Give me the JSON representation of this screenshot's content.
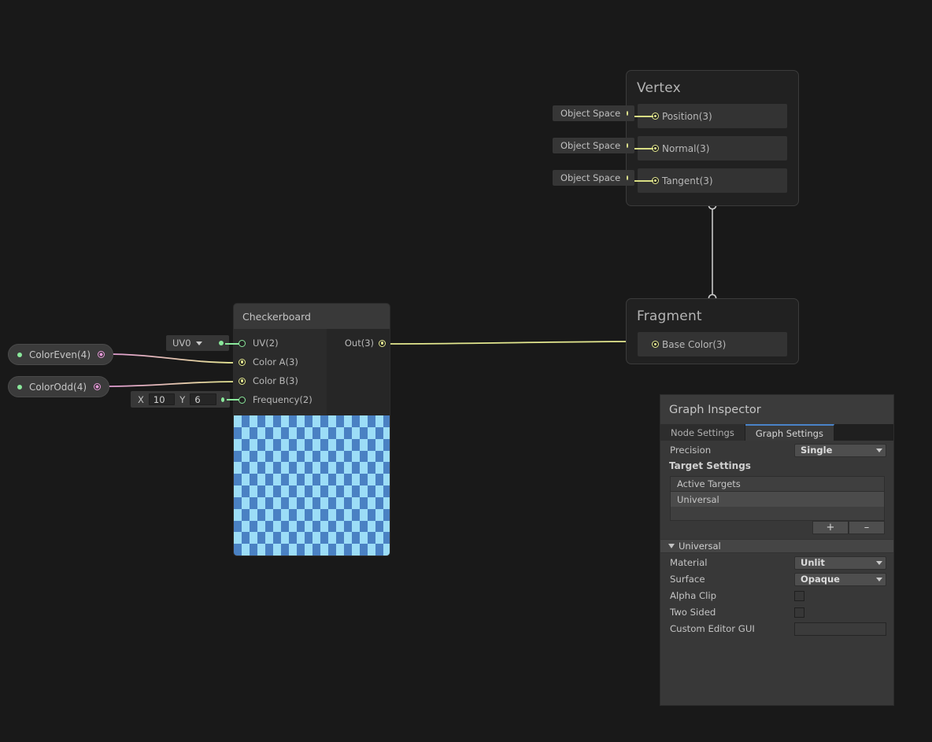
{
  "graph": {
    "vertex_node": {
      "title": "Vertex",
      "blocks": [
        {
          "label": "Position(3)",
          "space": "Object Space"
        },
        {
          "label": "Normal(3)",
          "space": "Object Space"
        },
        {
          "label": "Tangent(3)",
          "space": "Object Space"
        }
      ]
    },
    "fragment_node": {
      "title": "Fragment",
      "blocks": [
        {
          "label": "Base Color(3)"
        }
      ]
    },
    "checkerboard_node": {
      "title": "Checkerboard",
      "inputs": [
        {
          "label": "UV(2)"
        },
        {
          "label": "Color A(3)"
        },
        {
          "label": "Color B(3)"
        },
        {
          "label": "Frequency(2)"
        }
      ],
      "outputs": [
        {
          "label": "Out(3)"
        }
      ],
      "uv_dropdown": "UV0",
      "frequency": {
        "x_label": "X",
        "x_value": "10",
        "y_label": "Y",
        "y_value": "6"
      },
      "preview": {
        "color_light": "#9cddf7",
        "color_dark": "#4a81c3",
        "cols": 20,
        "rows": 12
      }
    },
    "properties": [
      {
        "label": "ColorEven(4)"
      },
      {
        "label": "ColorOdd(4)"
      }
    ],
    "edge_colors": {
      "vector3": "#e4e88f",
      "vector2": "#8ae89b",
      "vector4": "#e39ad6",
      "flow": "#c8c8c8"
    }
  },
  "inspector": {
    "title": "Graph Inspector",
    "tabs": [
      {
        "label": "Node Settings",
        "active": false
      },
      {
        "label": "Graph Settings",
        "active": true
      }
    ],
    "precision": {
      "label": "Precision",
      "value": "Single"
    },
    "target_settings_header": "Target Settings",
    "active_targets": {
      "header": "Active Targets",
      "items": [
        "Universal"
      ],
      "add_label": "+",
      "remove_label": "–"
    },
    "universal": {
      "foldout_label": "Universal",
      "material": {
        "label": "Material",
        "value": "Unlit"
      },
      "surface": {
        "label": "Surface",
        "value": "Opaque"
      },
      "alpha_clip": {
        "label": "Alpha Clip",
        "checked": false
      },
      "two_sided": {
        "label": "Two Sided",
        "checked": false
      },
      "custom_editor_gui": {
        "label": "Custom Editor GUI",
        "value": ""
      }
    }
  }
}
